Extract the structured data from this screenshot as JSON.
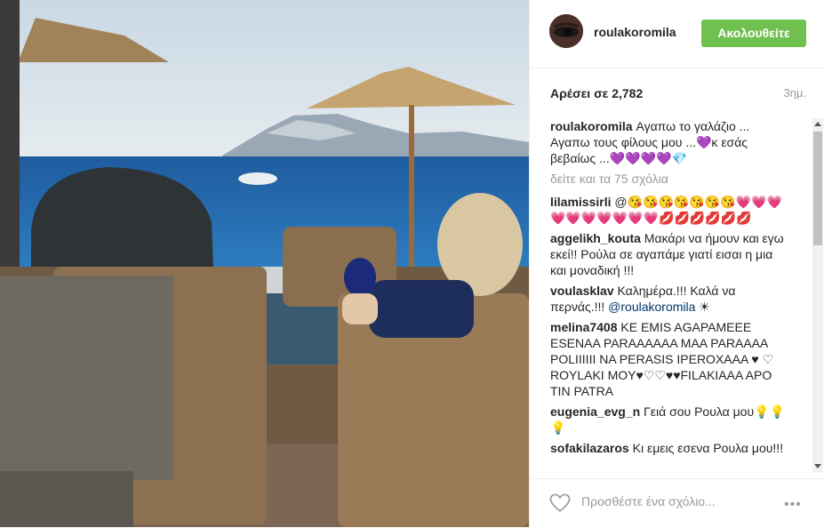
{
  "post": {
    "username": "roulakoromila",
    "follow_label": "Ακολουθείτε",
    "likes": "Αρέσει σε 2,782",
    "time": "3ημ.",
    "view_more": "δείτε και τα 75 σχόλια",
    "caption": {
      "user": "roulakoromila",
      "text": " Αγαπω το γαλάζιο ... Αγαπω τους φίλους μου ...💜κ εσάς βεβαίως ...💜💜💜💜💎"
    }
  },
  "comments": [
    {
      "user": "lilamissirli",
      "text": " @😘😘😘😘😘😘😘💗💗💗💗💗💗💗💗💗💗💋💋💋💋💋💋"
    },
    {
      "user": "aggelikh_kouta",
      "text": " Μακάρι να ήμουν και εγω εκεί!! Ρούλα σε αγαπάμε γιατί εισαι η μια και μοναδική !!!"
    },
    {
      "user": "voulasklav",
      "text": " Καλημέρα.!!! Καλά να περνάς.!!! ",
      "mention": "@roulakoromila",
      "after": " ☀"
    },
    {
      "user": "melina7408",
      "text": " ΚΕ EMIS AGAPAMEEE ESENAA PARAAAAAA MAA PARAAAA POLIIIIII NA PERASIS IPEROXAAA ♥ ♡ ROYLAKI MOY♥♡♡♥♥FILAKIAAA APO TIN PATRA"
    },
    {
      "user": "eugenia_evg_n",
      "text": " Γειά σου Ρουλα μου💡💡💡"
    },
    {
      "user": "sofakilazaros",
      "text": " Κι εμεις εσενα Ρουλα μου!!!"
    }
  ],
  "footer": {
    "placeholder": "Προσθέστε ένα σχόλιο...",
    "more_label": "•••"
  },
  "icons": {
    "heart": "heart-outline-icon",
    "more": "more-options-icon"
  },
  "colors": {
    "follow_bg": "#70c050",
    "mention": "#003569"
  }
}
